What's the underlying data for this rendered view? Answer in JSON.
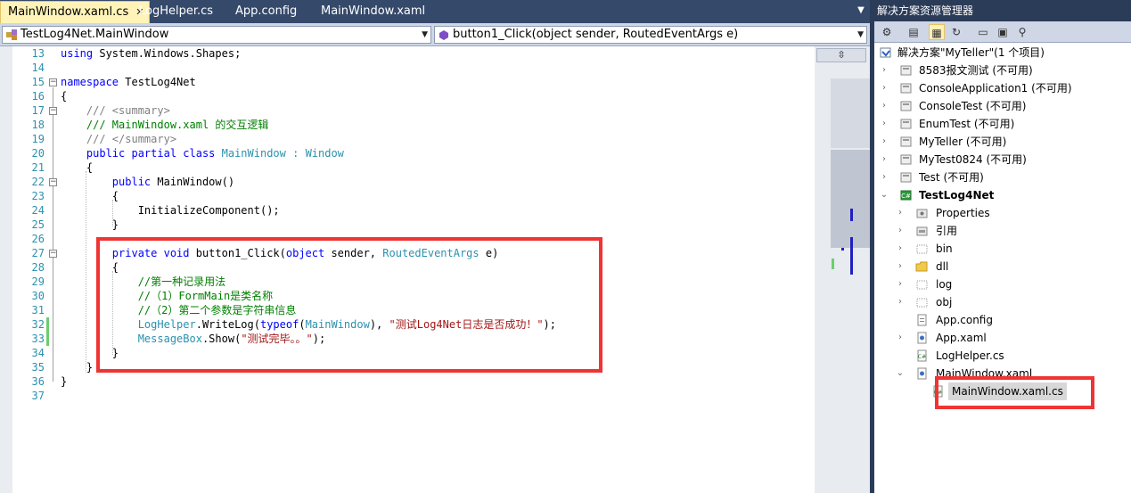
{
  "tabs": [
    {
      "label": "MainWindow.xaml.cs",
      "active": true
    },
    {
      "label": "LogHelper.cs",
      "active": false
    },
    {
      "label": "App.config",
      "active": false
    },
    {
      "label": "MainWindow.xaml",
      "active": false
    }
  ],
  "nav": {
    "class_combo": "TestLog4Net.MainWindow",
    "member_combo": "button1_Click(object sender, RoutedEventArgs e)"
  },
  "line_numbers": [
    "13",
    "14",
    "15",
    "16",
    "17",
    "18",
    "19",
    "20",
    "21",
    "22",
    "23",
    "24",
    "25",
    "26",
    "27",
    "28",
    "29",
    "30",
    "31",
    "32",
    "33",
    "34",
    "35",
    "36",
    "37"
  ],
  "code": {
    "l13a": "using",
    "l13b": " System.Windows.Shapes;",
    "l15a": "namespace",
    "l15b": " TestLog4Net",
    "l16": "{",
    "l17a": "    /// ",
    "l17b": "<summary>",
    "l18a": "    /// MainWindow.xaml 的交互逻辑",
    "l19a": "    /// ",
    "l19b": "</summary>",
    "l20a": "    public partial class",
    "l20b": " ",
    "l20c": "MainWindow",
    "l20d": " : ",
    "l20e": "Window",
    "l21": "    {",
    "l22a": "        public",
    "l22b": " MainWindow()",
    "l23": "        {",
    "l24": "            InitializeComponent();",
    "l25": "        }",
    "l27a": "        private void",
    "l27b": " button1_Click(",
    "l27c": "object",
    "l27d": " sender, ",
    "l27e": "RoutedEventArgs",
    "l27f": " e)",
    "l28": "        {",
    "l29": "            //第一种记录用法",
    "l30": "            //（1）FormMain是类名称",
    "l31": "            //（2）第二个参数是字符串信息",
    "l32a": "            ",
    "l32b": "LogHelper",
    "l32c": ".WriteLog(",
    "l32d": "typeof",
    "l32e": "(",
    "l32f": "MainWindow",
    "l32g": "), ",
    "l32h": "\"测试Log4Net日志是否成功！\"",
    "l32i": ");",
    "l33a": "            ",
    "l33b": "MessageBox",
    "l33c": ".Show(",
    "l33d": "\"测试完毕。。\"",
    "l33e": ");",
    "l34": "        }",
    "l35": "    }",
    "l36": "}"
  },
  "solution_explorer": {
    "title": "解决方案资源管理器",
    "solution": "解决方案\"MyTeller\"(1 个项目)",
    "projects": [
      {
        "label": "8583报文测试 (不可用)"
      },
      {
        "label": "ConsoleApplication1 (不可用)"
      },
      {
        "label": "ConsoleTest (不可用)"
      },
      {
        "label": "EnumTest (不可用)"
      },
      {
        "label": "MyTeller (不可用)"
      },
      {
        "label": "MyTest0824 (不可用)"
      },
      {
        "label": "Test (不可用)"
      }
    ],
    "active_project": "TestLog4Net",
    "items": [
      {
        "label": "Properties"
      },
      {
        "label": "引用"
      },
      {
        "label": "bin"
      },
      {
        "label": "dll"
      },
      {
        "label": "log"
      },
      {
        "label": "obj"
      },
      {
        "label": "App.config"
      },
      {
        "label": "App.xaml"
      },
      {
        "label": "LogHelper.cs"
      },
      {
        "label": "MainWindow.xaml"
      }
    ],
    "selected_file": "MainWindow.xaml.cs"
  },
  "colors": {
    "highlight_border": "#ef3434",
    "keyword": "#0000ff",
    "type": "#2b91af",
    "comment": "#008000",
    "string": "#a31515"
  }
}
